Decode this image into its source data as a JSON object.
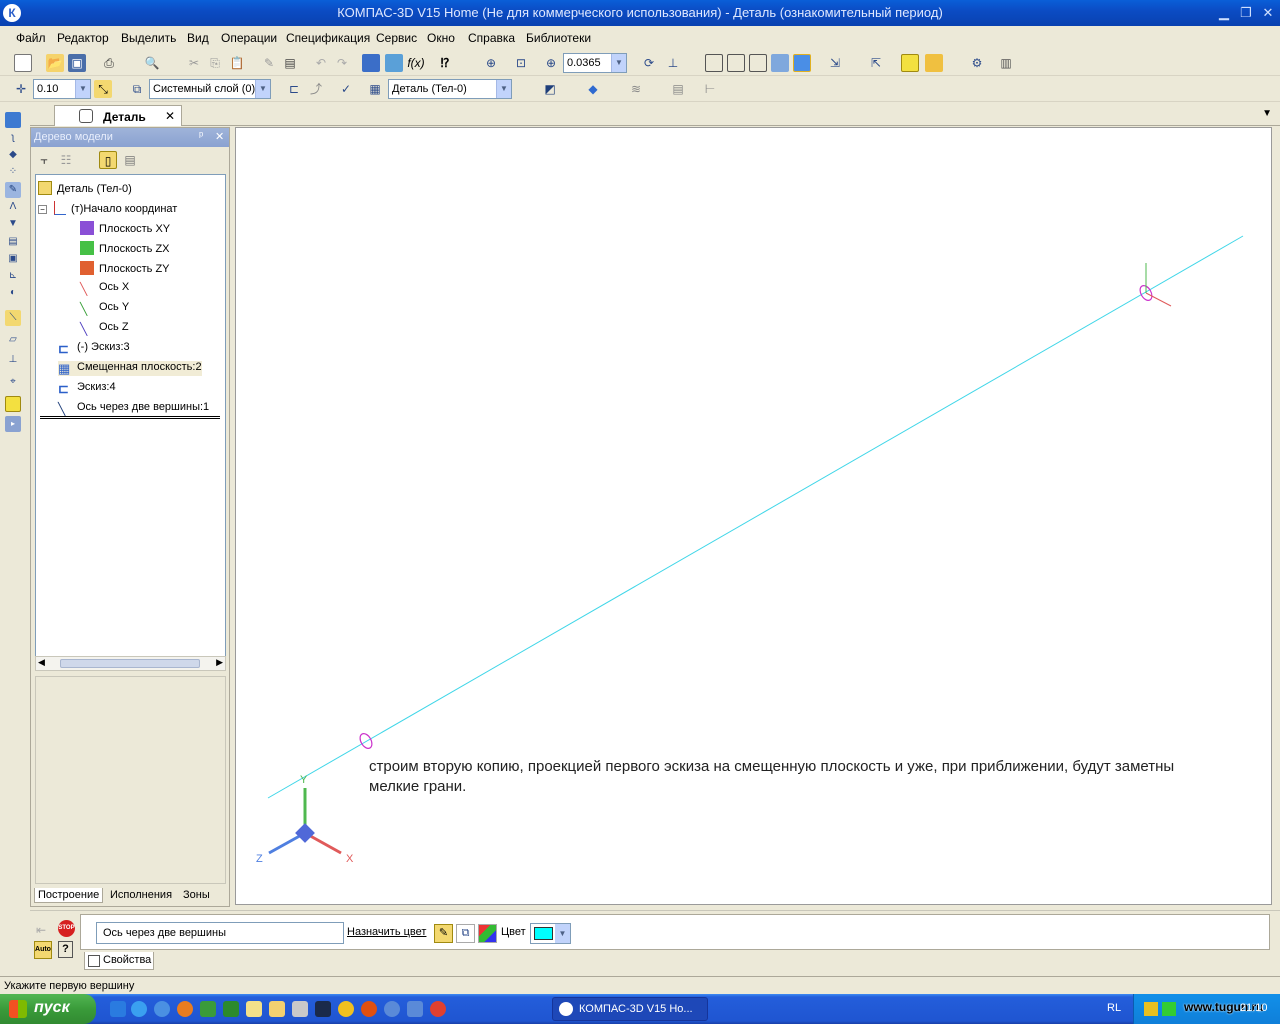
{
  "window": {
    "title": "КОМПАС-3D V15 Home (Не для коммерческого использования) - Деталь (ознакомительный период)",
    "app_icon": "К"
  },
  "menu": [
    "Файл",
    "Редактор",
    "Выделить",
    "Вид",
    "Операции",
    "Спецификация",
    "Сервис",
    "Окно",
    "Справка",
    "Библиотеки"
  ],
  "toolbar1": {
    "zoom_value": "0.0365"
  },
  "toolbar2": {
    "step_value": "0.10",
    "layer_value": "Системный слой (0)",
    "state_value": "Деталь (Тел-0)"
  },
  "document_tab": {
    "label": "Деталь",
    "close": "✕"
  },
  "tree_panel": {
    "title": "Дерево модели",
    "pin": "ᵖ",
    "close": "✕",
    "items": [
      {
        "label": "Деталь (Тел-0)"
      },
      {
        "label": "(т)Начало координат"
      },
      {
        "label": "Плоскость XY"
      },
      {
        "label": "Плоскость ZX"
      },
      {
        "label": "Плоскость ZY"
      },
      {
        "label": "Ось X"
      },
      {
        "label": "Ось Y"
      },
      {
        "label": "Ось Z"
      },
      {
        "label": "(-) Эскиз:3"
      },
      {
        "label": "Смещенная плоскость:2"
      },
      {
        "label": "Эскиз:4"
      },
      {
        "label": "Ось через две вершины:1"
      }
    ],
    "tabs": [
      "Построение",
      "Исполнения",
      "Зоны"
    ]
  },
  "canvas": {
    "caption_line1": "строим вторую копию, проекцией первого эскиза на смещенную плоскость и уже, при приближении, будут заметны",
    "caption_line2": "мелкие грани.",
    "axis_x": "X",
    "axis_y": "Y",
    "axis_z": "Z",
    "colors": {
      "line": "#3fd6e8",
      "vertex": "#cc33cc",
      "axis_x": "#e05a5a",
      "axis_y": "#4fb84f",
      "axis_z": "#4f7fe0"
    }
  },
  "property_bar": {
    "object_name": "Ось через две вершины",
    "assign_color_label": "Назначить цвет",
    "color_label": "Цвет",
    "color_value": "#00ffff",
    "properties_tab": "Свойства",
    "stop_label": "STOP",
    "auto_label": "Auto",
    "help_label": "?"
  },
  "status": {
    "text": "Укажите первую вершину"
  },
  "taskbar": {
    "start_label": "пуск",
    "app_button": "КОМПАС-3D V15 Ho...",
    "lang": "RL",
    "watermark": "www.tugun.ru",
    "clock": "21:10"
  }
}
